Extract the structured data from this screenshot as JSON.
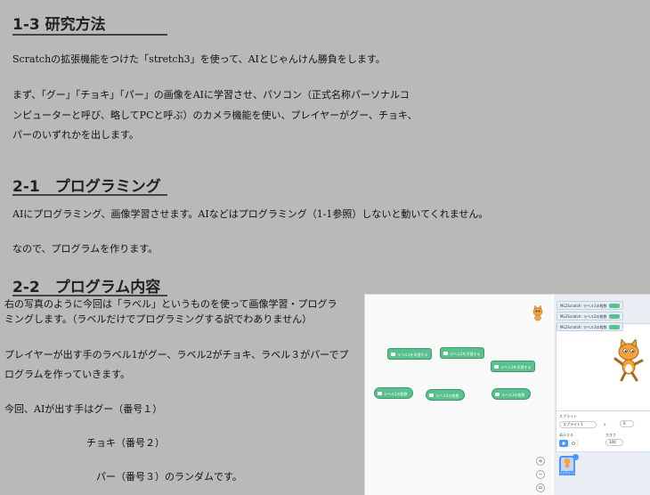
{
  "section1": {
    "heading": "1-3 研究方法",
    "para1": "Scratchの拡張機能をつけた「stretch3」を使って、AIとじゃんけん勝負をします。",
    "para2_lines": [
      "まず、「グー」「チョキ」「パー」の画像をAIに学習させ、パソコン（正式名称パーソナルコ",
      "ンピューターと呼び、略してPCと呼ぶ）のカメラ機能を使い、プレイヤーがグー、チョキ、",
      "パーのいずれかを出します。"
    ]
  },
  "section2": {
    "heading": "2-1　プログラミング",
    "para1": "AIにプログラミング、画像学習させます。AIなどはプログラミング（1-1参照）しないと動いてくれません。",
    "para2": "なので、プログラムを作ります。"
  },
  "section3": {
    "heading": "2-2　プログラム内容",
    "lines": [
      "右の写真のように今回は「ラベル」というものを使って画像学習・プログラ",
      "ミングします。（ラベルだけでプログラミングする訳でわありません）",
      "プレイヤーが出す手のラベル1がグー、ラベル2がチョキ、ラベル３がパーでプ",
      "ログラムを作っていきます。",
      "今回、AIが出す手はグー（番号１）",
      "チョキ（番号２）",
      "パー（番号３）のランダムです。"
    ]
  },
  "scratch": {
    "blocks": [
      "ラベル1を学習する",
      "ラベル2を学習する",
      "ラベル3を学習する",
      "ラベル1の枚数",
      "ラベル2の枚数",
      "ラベル3の枚数"
    ],
    "monitors": [
      "ML2Scratch: ラベル1の枚数",
      "ML2Scratch: ラベル2の枚数",
      "ML2Scratch: ラベル3の枚数"
    ],
    "zoom": [
      "+",
      "−",
      "="
    ],
    "sprite_label": "スプライト",
    "sprite_name": "スプライト1",
    "show_label": "表示する",
    "size_label": "大きさ",
    "size_value": "100",
    "x_label": "x",
    "x_value": "0",
    "thumb_label": "スプライト1"
  },
  "colors": {
    "background": "#b9b9b9",
    "block_green": "#59c08e",
    "scratch_blue": "#4c97ff"
  }
}
